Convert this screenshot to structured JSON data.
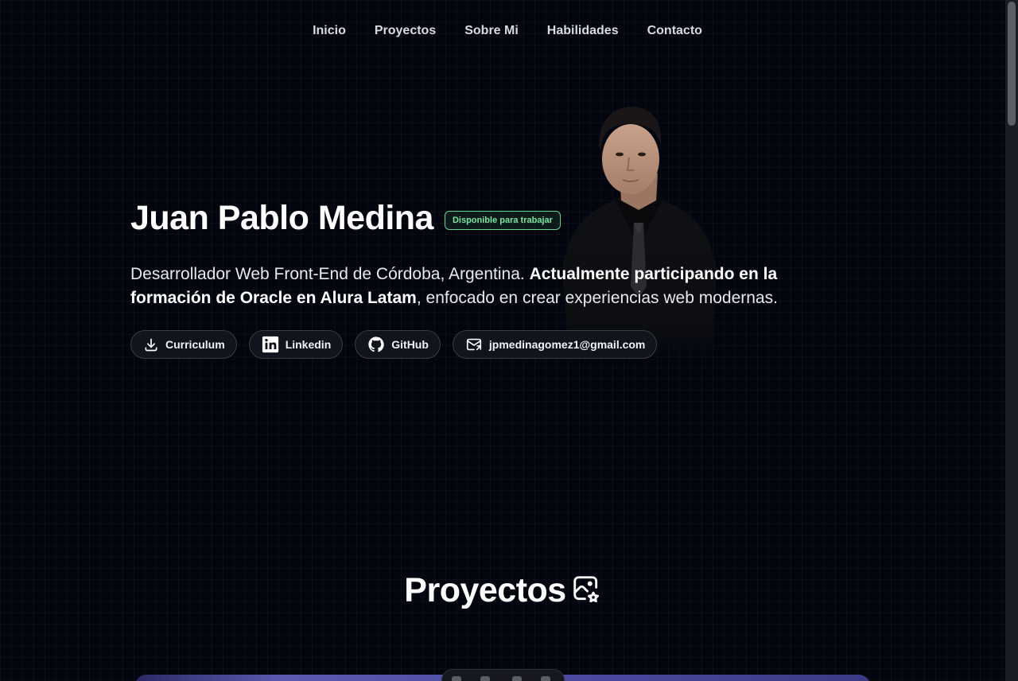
{
  "nav": {
    "items": [
      {
        "label": "Inicio"
      },
      {
        "label": "Proyectos"
      },
      {
        "label": "Sobre Mi"
      },
      {
        "label": "Habilidades"
      },
      {
        "label": "Contacto"
      }
    ]
  },
  "hero": {
    "name": "Juan Pablo Medina",
    "badge": "Disponible para trabajar",
    "desc_part1": "Desarrollador Web Front-End de Córdoba, Argentina. ",
    "desc_bold": "Actualmente participando en la formación de Oracle en Alura Latam",
    "desc_part2": ", enfocado en crear experiencias web modernas.",
    "photo_icon": "profile-photo"
  },
  "links": {
    "cv": {
      "label": "Curriculum",
      "icon": "download-icon"
    },
    "linkedin": {
      "label": "Linkedin",
      "icon": "linkedin-icon"
    },
    "github": {
      "label": "GitHub",
      "icon": "github-icon"
    },
    "email": {
      "label": "jpmedinagomez1@gmail.com",
      "icon": "mail-icon"
    }
  },
  "projects": {
    "title": "Proyectos",
    "icon": "photo-star-icon"
  },
  "colors": {
    "background": "#03050f",
    "badge_accent": "#5fd68d",
    "card_accent": "#5a5ab0"
  }
}
